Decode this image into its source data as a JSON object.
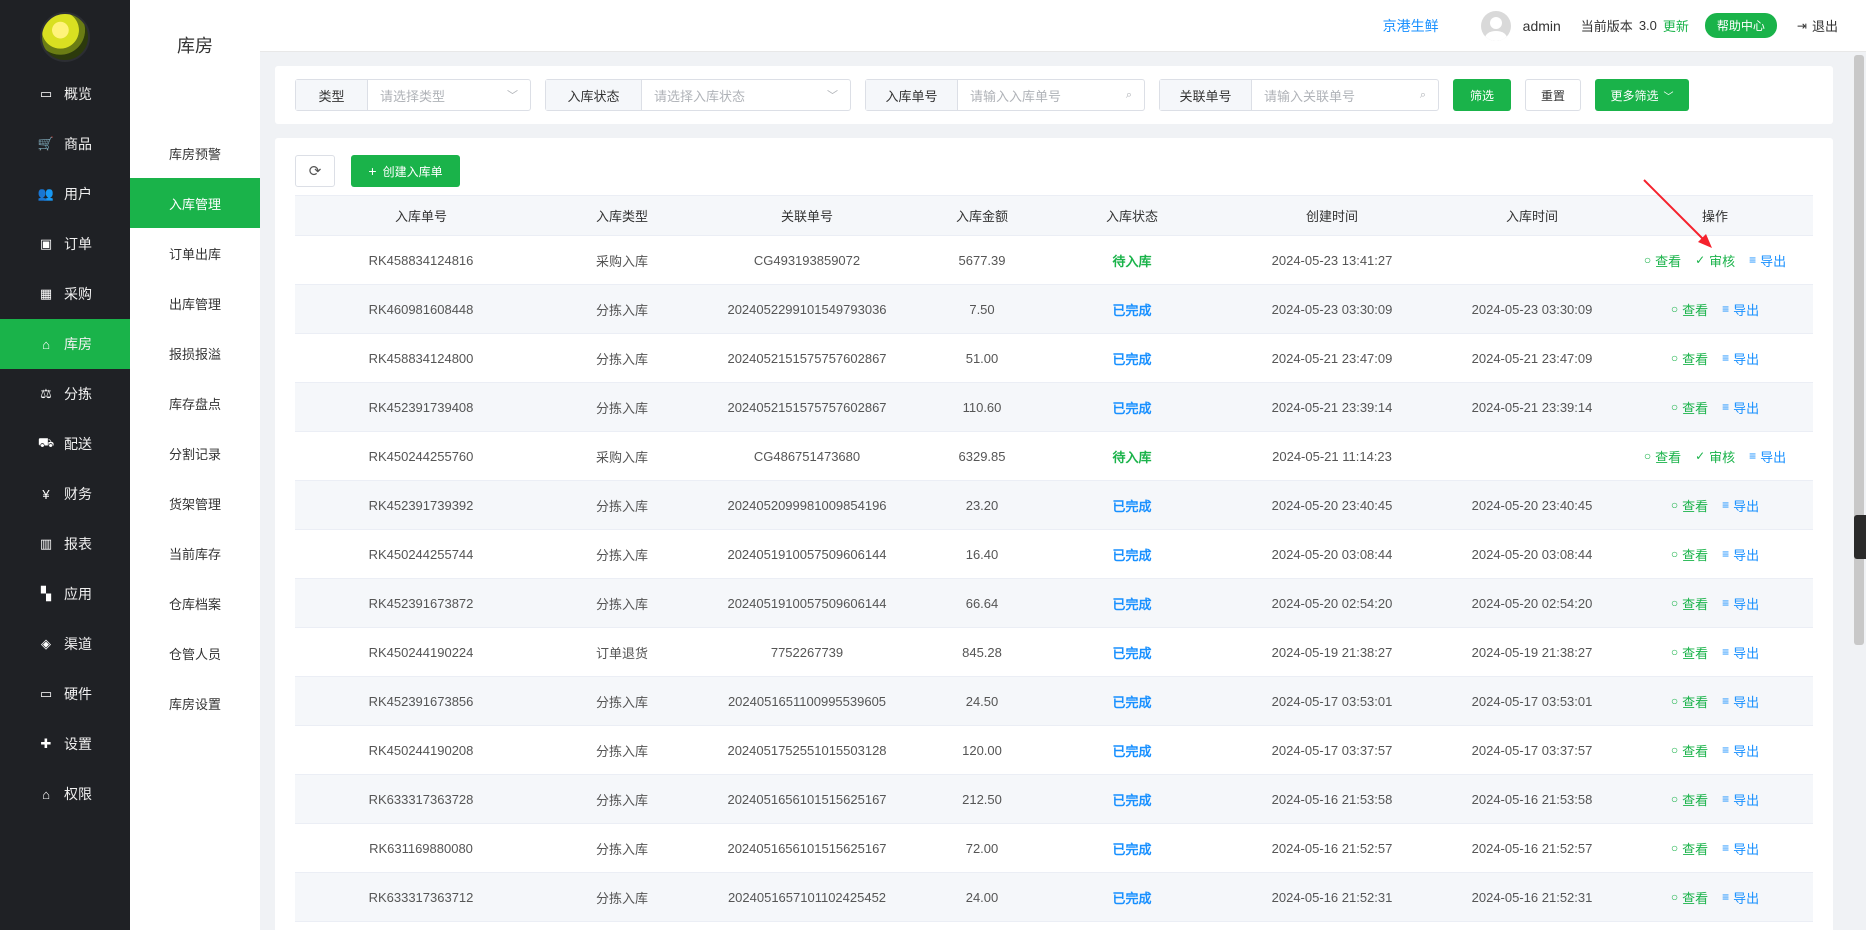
{
  "nav": {
    "items": [
      {
        "label": "概览",
        "icon": "monitor-icon",
        "glyph": "▭",
        "active": false
      },
      {
        "label": "商品",
        "icon": "cart-icon",
        "glyph": "🛒",
        "active": false
      },
      {
        "label": "用户",
        "icon": "users-icon",
        "glyph": "👥",
        "active": false
      },
      {
        "label": "订单",
        "icon": "money-icon",
        "glyph": "▣",
        "active": false
      },
      {
        "label": "采购",
        "icon": "train-icon",
        "glyph": "▦",
        "active": false
      },
      {
        "label": "库房",
        "icon": "home-icon",
        "glyph": "⌂",
        "active": true
      },
      {
        "label": "分拣",
        "icon": "scale-icon",
        "glyph": "⚖",
        "active": false
      },
      {
        "label": "配送",
        "icon": "truck-icon",
        "glyph": "⛟",
        "active": false
      },
      {
        "label": "财务",
        "icon": "yen-icon",
        "glyph": "¥",
        "active": false
      },
      {
        "label": "报表",
        "icon": "bar-chart-icon",
        "glyph": "▥",
        "active": false
      },
      {
        "label": "应用",
        "icon": "apps-icon",
        "glyph": "▚",
        "active": false
      },
      {
        "label": "渠道",
        "icon": "cube-icon",
        "glyph": "◈",
        "active": false
      },
      {
        "label": "硬件",
        "icon": "desktop-icon",
        "glyph": "▭",
        "active": false
      },
      {
        "label": "设置",
        "icon": "puzzle-icon",
        "glyph": "✚",
        "active": false
      },
      {
        "label": "权限",
        "icon": "bank-icon",
        "glyph": "⌂",
        "active": false
      }
    ]
  },
  "subnav": {
    "title": "库房",
    "items": [
      {
        "label": "库房预警",
        "active": false
      },
      {
        "label": "入库管理",
        "active": true
      },
      {
        "label": "订单出库",
        "active": false
      },
      {
        "label": "出库管理",
        "active": false
      },
      {
        "label": "报损报溢",
        "active": false
      },
      {
        "label": "库存盘点",
        "active": false
      },
      {
        "label": "分割记录",
        "active": false
      },
      {
        "label": "货架管理",
        "active": false
      },
      {
        "label": "当前库存",
        "active": false
      },
      {
        "label": "仓库档案",
        "active": false
      },
      {
        "label": "仓管人员",
        "active": false
      },
      {
        "label": "库房设置",
        "active": false
      }
    ]
  },
  "header": {
    "shop": "京港生鲜",
    "user": "admin",
    "version_label": "当前版本",
    "version": "3.0",
    "update": "更新",
    "help": "帮助中心",
    "logout": "退出"
  },
  "filters": {
    "type_label": "类型",
    "type_placeholder": "请选择类型",
    "status_label": "入库状态",
    "status_placeholder": "请选择入库状态",
    "no_label": "入库单号",
    "no_placeholder": "请输入入库单号",
    "rel_label": "关联单号",
    "rel_placeholder": "请输入关联单号",
    "search_btn": "筛选",
    "reset_btn": "重置",
    "more_btn": "更多筛选"
  },
  "toolbar": {
    "create_btn": "创建入库单"
  },
  "table": {
    "headers": [
      "入库单号",
      "入库类型",
      "关联单号",
      "入库金额",
      "入库状态",
      "创建时间",
      "入库时间",
      "操作"
    ],
    "ops": {
      "view": "查看",
      "audit": "审核",
      "export": "导出"
    },
    "rows": [
      {
        "no": "RK458834124816",
        "type": "采购入库",
        "rel": "CG493193859072",
        "amount": "5677.39",
        "status": "待入库",
        "pending": true,
        "created": "2024-05-23 13:41:27",
        "stocked": ""
      },
      {
        "no": "RK460981608448",
        "type": "分拣入库",
        "rel": "20240522991015497930​36",
        "amount": "7.50",
        "status": "已完成",
        "pending": false,
        "created": "2024-05-23 03:30:09",
        "stocked": "2024-05-23 03:30:09"
      },
      {
        "no": "RK458834124800",
        "type": "分拣入库",
        "rel": "20240521515757576028​67",
        "amount": "51.00",
        "status": "已完成",
        "pending": false,
        "created": "2024-05-21 23:47:09",
        "stocked": "2024-05-21 23:47:09"
      },
      {
        "no": "RK452391739408",
        "type": "分拣入库",
        "rel": "20240521515757576028​67",
        "amount": "110.60",
        "status": "已完成",
        "pending": false,
        "created": "2024-05-21 23:39:14",
        "stocked": "2024-05-21 23:39:14"
      },
      {
        "no": "RK450244255760",
        "type": "采购入库",
        "rel": "CG486751473680",
        "amount": "6329.85",
        "status": "待入库",
        "pending": true,
        "created": "2024-05-21 11:14:23",
        "stocked": ""
      },
      {
        "no": "RK452391739392",
        "type": "分拣入库",
        "rel": "20240520999810098541​96",
        "amount": "23.20",
        "status": "已完成",
        "pending": false,
        "created": "2024-05-20 23:40:45",
        "stocked": "2024-05-20 23:40:45"
      },
      {
        "no": "RK450244255744",
        "type": "分拣入库",
        "rel": "20240519100575096061​44",
        "amount": "16.40",
        "status": "已完成",
        "pending": false,
        "created": "2024-05-20 03:08:44",
        "stocked": "2024-05-20 03:08:44"
      },
      {
        "no": "RK452391673872",
        "type": "分拣入库",
        "rel": "20240519100575096061​44",
        "amount": "66.64",
        "status": "已完成",
        "pending": false,
        "created": "2024-05-20 02:54:20",
        "stocked": "2024-05-20 02:54:20"
      },
      {
        "no": "RK450244190224",
        "type": "订单退货",
        "rel": "7752267739",
        "amount": "845.28",
        "status": "已完成",
        "pending": false,
        "created": "2024-05-19 21:38:27",
        "stocked": "2024-05-19 21:38:27"
      },
      {
        "no": "RK452391673856",
        "type": "分拣入库",
        "rel": "20240516511009955396​05",
        "amount": "24.50",
        "status": "已完成",
        "pending": false,
        "created": "2024-05-17 03:53:01",
        "stocked": "2024-05-17 03:53:01"
      },
      {
        "no": "RK450244190208",
        "type": "分拣入库",
        "rel": "20240517525510155031​28",
        "amount": "120.00",
        "status": "已完成",
        "pending": false,
        "created": "2024-05-17 03:37:57",
        "stocked": "2024-05-17 03:37:57"
      },
      {
        "no": "RK633317363728",
        "type": "分拣入库",
        "rel": "20240516561015156251​67",
        "amount": "212.50",
        "status": "已完成",
        "pending": false,
        "created": "2024-05-16 21:53:58",
        "stocked": "2024-05-16 21:53:58"
      },
      {
        "no": "RK631169880080",
        "type": "分拣入库",
        "rel": "20240516561015156251​67",
        "amount": "72.00",
        "status": "已完成",
        "pending": false,
        "created": "2024-05-16 21:52:57",
        "stocked": "2024-05-16 21:52:57"
      },
      {
        "no": "RK633317363712",
        "type": "分拣入库",
        "rel": "20240516571011024254​52",
        "amount": "24.00",
        "status": "已完成",
        "pending": false,
        "created": "2024-05-16 21:52:31",
        "stocked": "2024-05-16 21:52:31"
      }
    ]
  },
  "colors": {
    "accent": "#1ab34a",
    "link": "#1890ff",
    "nav_bg": "#1f2125"
  }
}
